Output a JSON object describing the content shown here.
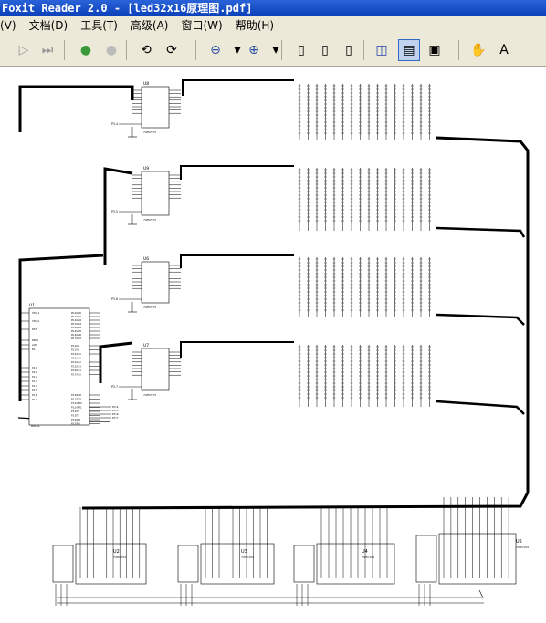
{
  "window": {
    "title": "Foxit Reader 2.0 - [led32x16原理图.pdf]"
  },
  "menu": [
    "(V)",
    "文档(D)",
    "工具(T)",
    "高级(A)",
    "窗口(W)",
    "帮助(H)"
  ],
  "toolbar": {
    "buttons": [
      {
        "name": "play-icon",
        "glyph": "▷"
      },
      {
        "name": "last-page-icon",
        "glyph": "⏭"
      },
      {
        "name": "back-icon",
        "glyph": "●"
      },
      {
        "name": "forward-icon",
        "glyph": "●"
      },
      {
        "name": "rotate-left-icon",
        "glyph": "⟲"
      },
      {
        "name": "rotate-right-icon",
        "glyph": "⟳"
      },
      {
        "name": "zoom-out-icon",
        "glyph": "⊖"
      },
      {
        "name": "zoom-dropdown-icon",
        "glyph": "▾"
      },
      {
        "name": "zoom-in-icon",
        "glyph": "⊕"
      },
      {
        "name": "zoom-dropdown-icon",
        "glyph": "▾"
      },
      {
        "name": "page-actual-icon",
        "glyph": "▯"
      },
      {
        "name": "fit-page-icon",
        "glyph": "▯"
      },
      {
        "name": "fit-width-icon",
        "glyph": "▯"
      },
      {
        "name": "binoculars-icon",
        "glyph": "◫"
      },
      {
        "name": "bookmarks-icon",
        "glyph": "▤"
      },
      {
        "name": "thumbnails-icon",
        "glyph": "▣"
      },
      {
        "name": "hand-tool-icon",
        "glyph": "✋"
      },
      {
        "name": "text-select-icon",
        "glyph": "A"
      }
    ]
  },
  "schematic": {
    "shift_registers": [
      {
        "ref": "U8",
        "part": "74HC573"
      },
      {
        "ref": "U9",
        "part": "74HC573"
      },
      {
        "ref": "U6",
        "part": "74HC573"
      },
      {
        "ref": "U7",
        "part": "74HC573"
      }
    ],
    "decoders": [
      {
        "ref": "U2",
        "part": "74HC154"
      },
      {
        "ref": "U3",
        "part": "74HC154"
      },
      {
        "ref": "U4",
        "part": "74HC154"
      },
      {
        "ref": "U5",
        "part": "74HC154"
      }
    ],
    "mcu": {
      "ref": "U1",
      "part": "80C51"
    },
    "pins_left": [
      "XTAL1",
      "XTAL2",
      "RST",
      "PSEN",
      "ALE",
      "EA",
      "P1.0",
      "P1.1",
      "P1.2",
      "P1.3",
      "P1.4",
      "P1.5",
      "P1.6",
      "P1.7"
    ],
    "pins_right": [
      "P0.0/AD0",
      "P0.1/AD1",
      "P0.2/AD2",
      "P0.3/AD3",
      "P0.4/AD4",
      "P0.5/AD5",
      "P0.6/AD6",
      "P0.7/AD7",
      "P2.0/A8",
      "P2.1/A9",
      "P2.2/A10",
      "P2.3/A11",
      "P2.4/A12",
      "P2.5/A13",
      "P2.6/A14",
      "P2.7/A15",
      "P3.0/RXD",
      "P3.1/TXD",
      "P3.2/INT0",
      "P3.3/INT1",
      "P3.4/T0",
      "P3.5/T1",
      "P3.6/WR",
      "P3.7/RD"
    ],
    "net_labels": [
      "P3.4",
      "P3.5",
      "P3.6",
      "P3.7"
    ]
  }
}
